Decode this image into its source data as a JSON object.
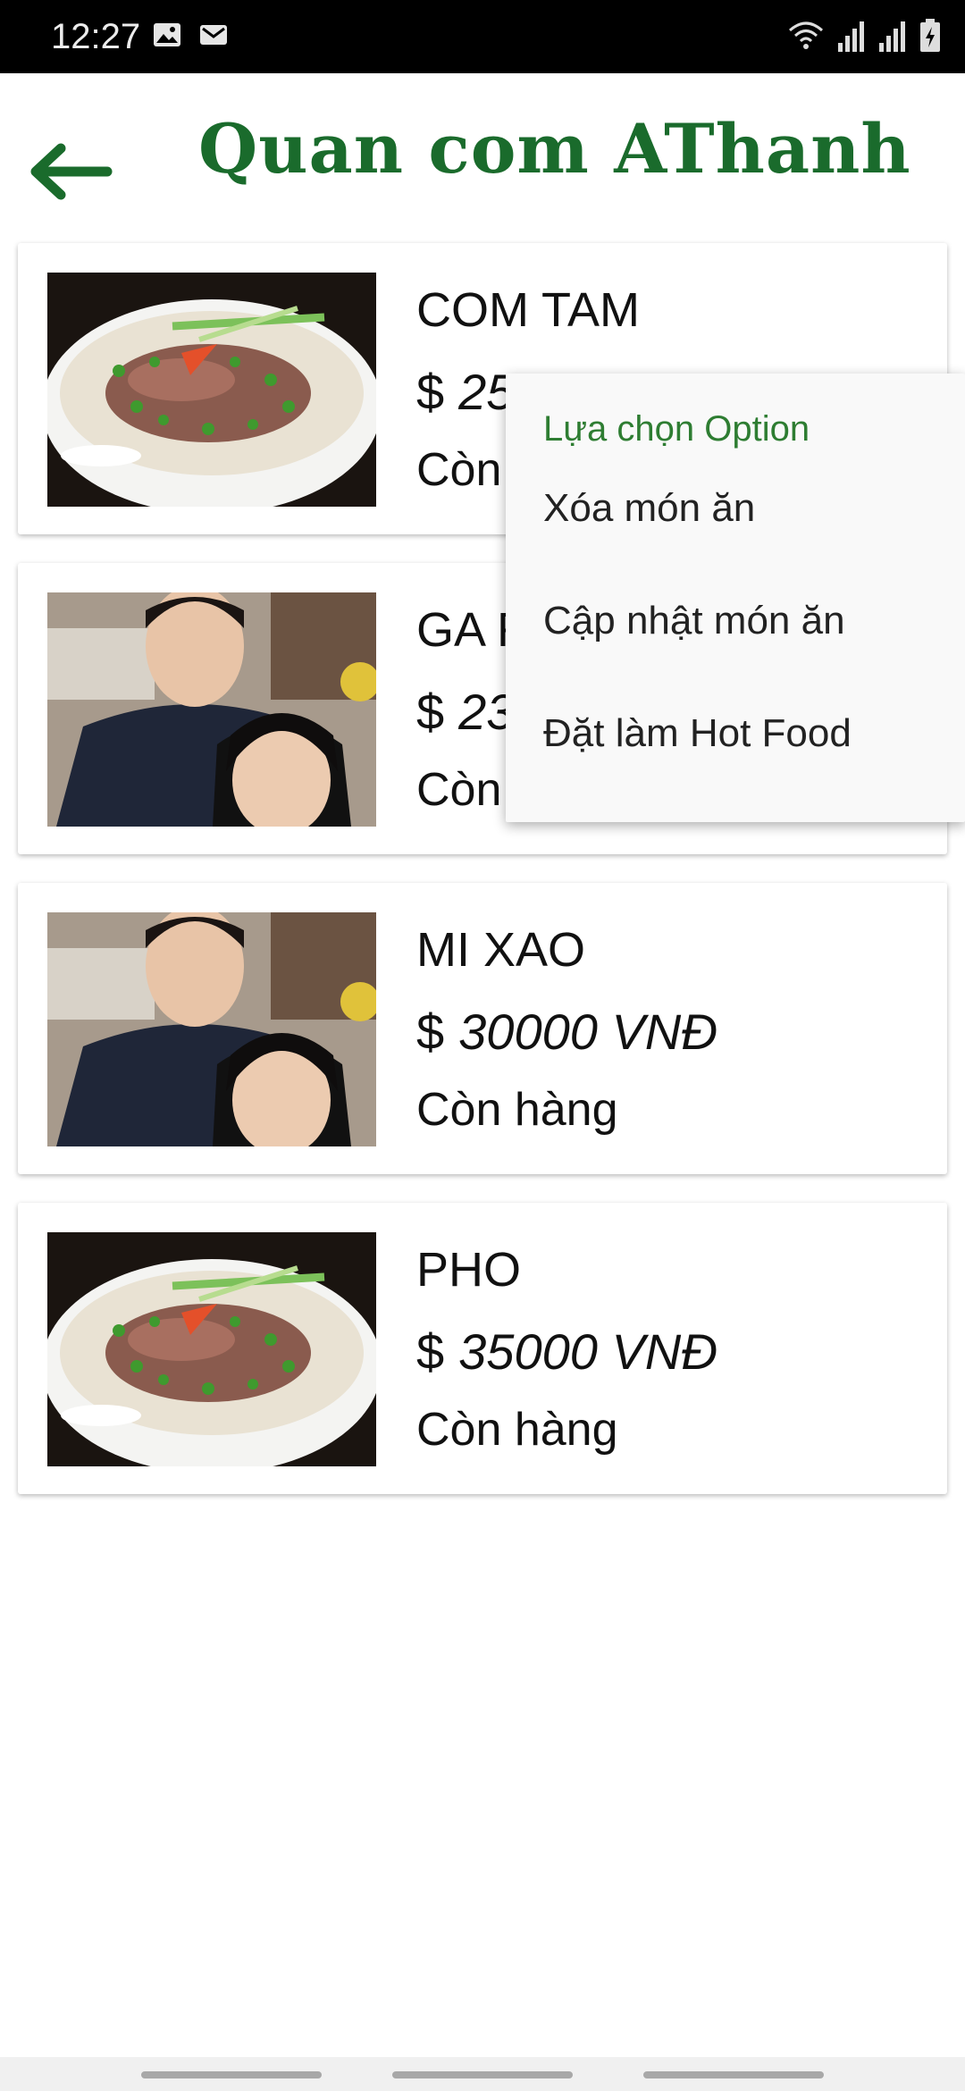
{
  "status_bar": {
    "time": "12:27",
    "left_icons": [
      "image-icon",
      "mail-icon"
    ],
    "right_icons": [
      "wifi-icon",
      "signal-icon",
      "signal-icon",
      "battery-charging-icon"
    ]
  },
  "app_bar": {
    "title": "Quan com AThanh",
    "back_icon": "back-arrow-icon",
    "title_color": "#1a6b2c"
  },
  "foods": [
    {
      "name": "COM TAM",
      "currency": "$",
      "price": "25000 VNĐ",
      "status": "Còn hàng",
      "image": "pho-bowl"
    },
    {
      "name": "GA RAN",
      "currency": "$",
      "price": "23000 VNĐ",
      "status": "Còn hàng",
      "image": "selfie-photo"
    },
    {
      "name": "MI XAO",
      "currency": "$",
      "price": "30000 VNĐ",
      "status": "Còn hàng",
      "image": "selfie-photo"
    },
    {
      "name": "PHO",
      "currency": "$",
      "price": "35000 VNĐ",
      "status": "Còn hàng",
      "image": "pho-bowl"
    }
  ],
  "context_menu": {
    "title": "Lựa chọn Option",
    "items": [
      "Xóa món ăn",
      "Cập nhật món ăn",
      "Đặt làm Hot Food"
    ],
    "accent": "#2e7d32"
  }
}
